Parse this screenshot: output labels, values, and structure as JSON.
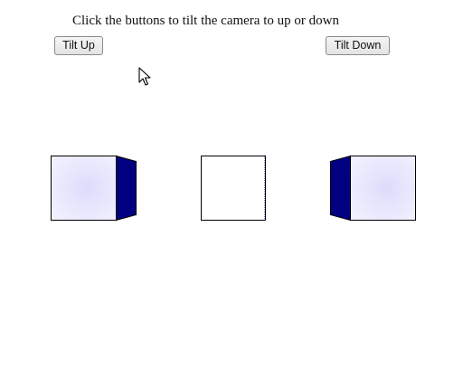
{
  "instruction": "Click the buttons to tilt the camera to up or down",
  "buttons": {
    "tilt_up": "Tilt Up",
    "tilt_down": "Tilt Down"
  },
  "cubes": {
    "front_color": "#e6e6fc",
    "side_color": "#000080",
    "edge_color": "#000000"
  },
  "cursor_icon": "mouse-pointer-icon"
}
